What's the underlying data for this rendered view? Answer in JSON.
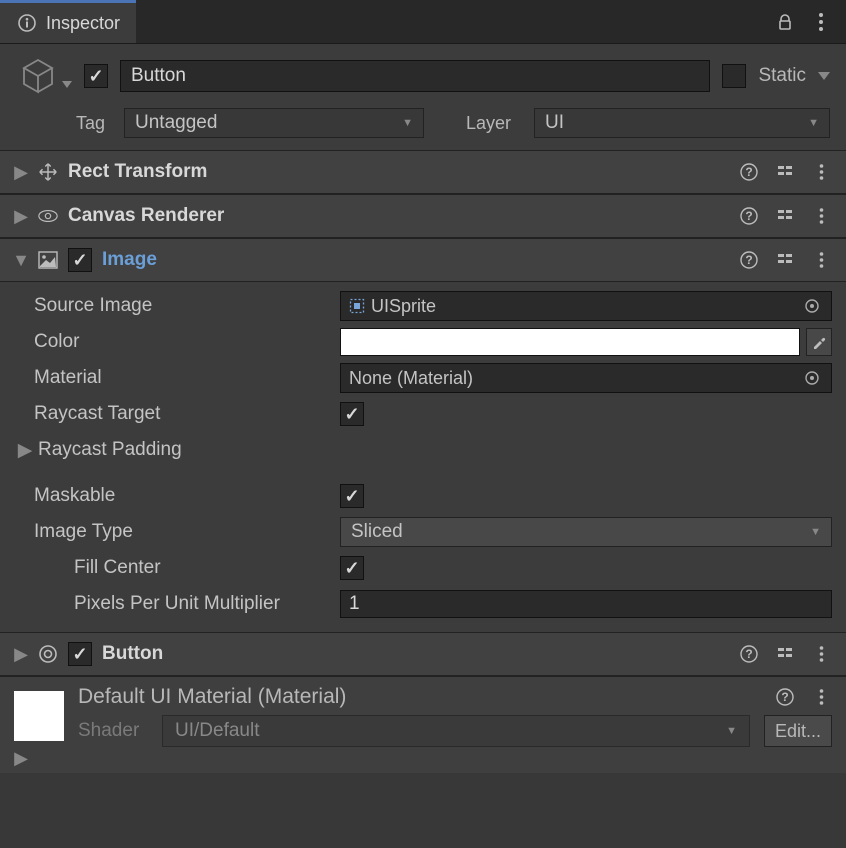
{
  "tab": {
    "title": "Inspector"
  },
  "header": {
    "enabled": true,
    "name": "Button",
    "static_label": "Static",
    "static_checked": false,
    "tag_label": "Tag",
    "tag_value": "Untagged",
    "layer_label": "Layer",
    "layer_value": "UI"
  },
  "components": {
    "rect": {
      "title": "Rect Transform"
    },
    "canvas": {
      "title": "Canvas Renderer"
    },
    "image": {
      "title": "Image",
      "enabled": true,
      "source_label": "Source Image",
      "source_value": "UISprite",
      "color_label": "Color",
      "color_value": "#FFFFFF",
      "material_label": "Material",
      "material_value": "None (Material)",
      "raycast_label": "Raycast Target",
      "raycast_checked": true,
      "raycast_pad_label": "Raycast Padding",
      "maskable_label": "Maskable",
      "maskable_checked": true,
      "imgtype_label": "Image Type",
      "imgtype_value": "Sliced",
      "fillcenter_label": "Fill Center",
      "fillcenter_checked": true,
      "ppu_label": "Pixels Per Unit Multiplier",
      "ppu_value": "1"
    },
    "button": {
      "title": "Button",
      "enabled": true
    }
  },
  "material": {
    "title": "Default UI Material (Material)",
    "shader_label": "Shader",
    "shader_value": "UI/Default",
    "edit_label": "Edit..."
  }
}
